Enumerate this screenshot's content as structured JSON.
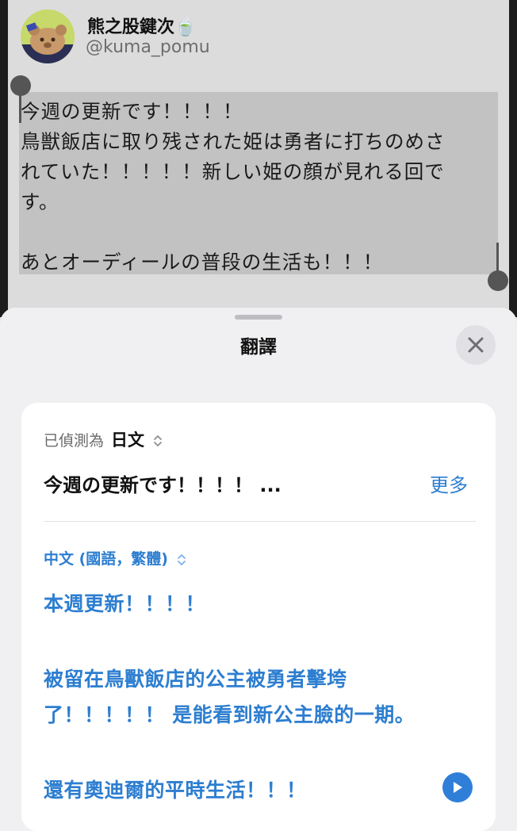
{
  "tweet": {
    "display_name": "熊之股鍵次🍵",
    "username": "@kuma_pomu",
    "lines": [
      "今週の更新です！！！！",
      "鳥獣飯店に取り残された姫は勇者に打ちのめさ",
      "れていた！！！！！新しい姫の顔が見れる回で",
      "す。",
      "あとオーディールの普段の生活も！！！"
    ]
  },
  "sheet": {
    "title": "翻譯",
    "detected_prefix": "已偵測為",
    "detected_language": "日文",
    "source_preview": "今週の更新です！！！！ ...",
    "more_label": "更多",
    "target_language": "中文 (國語，繁體)",
    "translation_lines": [
      "本週更新！！！！",
      "被留在鳥獸飯店的公主被勇者擊垮",
      "了！！！！！  是能看到新公主臉的一期。",
      "還有奧迪爾的平時生活！！！"
    ]
  },
  "icons": {
    "close": "close-icon",
    "play": "play-icon",
    "chevron": "chevron-updown-icon"
  },
  "colors": {
    "accent": "#2d7ed0",
    "selection": "#c2c2c2",
    "sheet_background": "#f0f0f3"
  }
}
